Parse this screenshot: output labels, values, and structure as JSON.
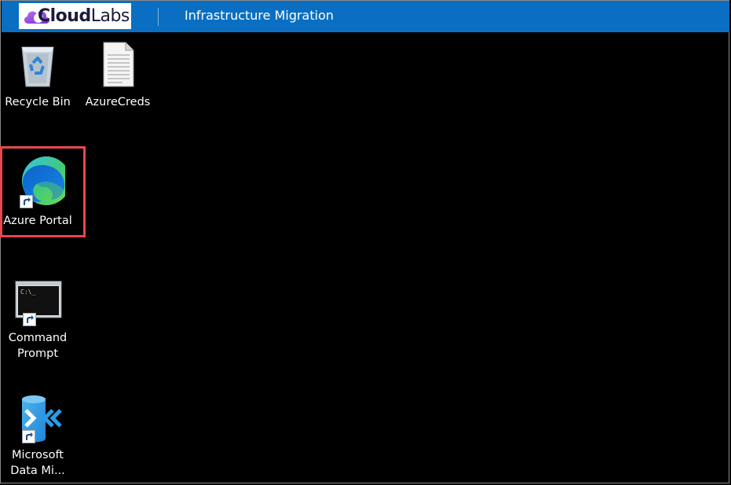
{
  "topbar": {
    "logo_text_cloud": "Cloud",
    "logo_text_labs": "Labs",
    "title": "Infrastructure Migration",
    "color": "#0a6fc2"
  },
  "desktop": {
    "background": "#000000",
    "icons": [
      {
        "label": "Recycle Bin",
        "icon": "recycle-bin-icon"
      },
      {
        "label": "AzureCreds",
        "icon": "text-document-icon"
      },
      {
        "label": "Azure Portal",
        "icon": "edge-browser-icon",
        "highlighted": true
      },
      {
        "label": "Command Prompt",
        "label_line1": "Command",
        "label_line2": "Prompt",
        "icon": "command-prompt-icon"
      },
      {
        "label": "Microsoft Data Mi...",
        "label_line1": "Microsoft",
        "label_line2": "Data Mi...",
        "icon": "data-migration-icon"
      }
    ],
    "highlight_color": "#e8474c"
  }
}
